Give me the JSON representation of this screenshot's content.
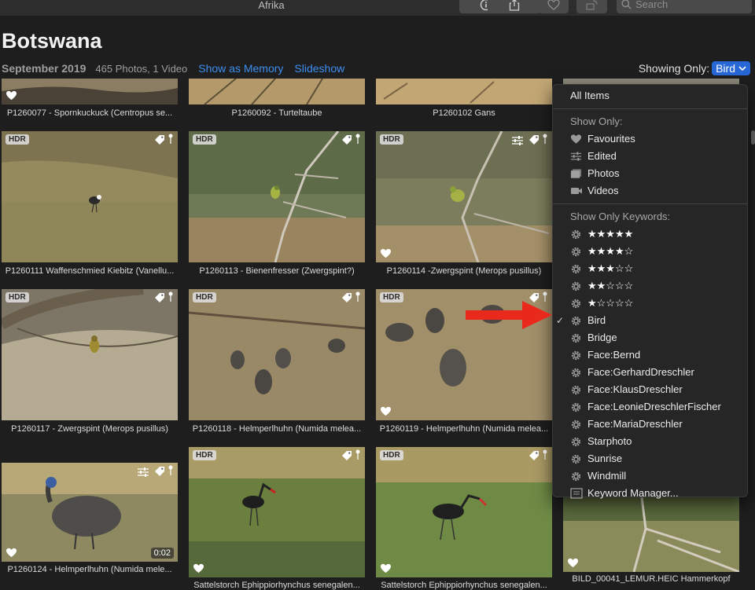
{
  "window": {
    "title": "Afrika"
  },
  "toolbar": {
    "search_placeholder": "Search"
  },
  "header": {
    "title": "Botswana",
    "date": "September 2019",
    "count": "465 Photos, 1 Video",
    "show_as_memory": "Show as Memory",
    "slideshow": "Slideshow",
    "showing_only_label": "Showing Only:",
    "filter_value": "Bird"
  },
  "photos": [
    {
      "caption": "P1260077 - Spornkuckuck (Centropus se...",
      "hdr": false,
      "tag": false,
      "adjusted": false,
      "favourite": true
    },
    {
      "caption": "P1260092 - Turteltaube",
      "hdr": false,
      "tag": false,
      "adjusted": false,
      "favourite": false
    },
    {
      "caption": "P1260102 Gans",
      "hdr": false,
      "tag": false,
      "adjusted": false,
      "favourite": false
    },
    {
      "caption": "P1260111 Waffenschmied Kiebitz (Vanellu...",
      "hdr": true,
      "hdr_label": "HDR",
      "tag": true,
      "adjusted": false,
      "favourite": false
    },
    {
      "caption": "P1260113 - Bienenfresser (Zwergspint?)",
      "hdr": true,
      "hdr_label": "HDR",
      "tag": true,
      "adjusted": false,
      "favourite": false
    },
    {
      "caption": "P1260114 -Zwergspint (Merops pusillus)",
      "hdr": true,
      "hdr_label": "HDR",
      "tag": true,
      "adjusted": true,
      "favourite": true
    },
    {
      "caption": "P1260117 - Zwergspint (Merops pusillus)",
      "hdr": true,
      "hdr_label": "HDR",
      "tag": true,
      "adjusted": false,
      "favourite": false
    },
    {
      "caption": "P1260118 - Helmperlhuhn (Numida melea...",
      "hdr": true,
      "hdr_label": "HDR",
      "tag": true,
      "adjusted": false,
      "favourite": false
    },
    {
      "caption": "P1260119 - Helmperlhuhn (Numida melea...",
      "hdr": true,
      "hdr_label": "HDR",
      "tag": true,
      "adjusted": false,
      "favourite": true
    },
    {
      "caption": "P1260124 - Helmperlhuhn (Numida mele...",
      "hdr": false,
      "tag": true,
      "adjusted": true,
      "favourite": true,
      "duration": "0:02"
    },
    {
      "caption": "Sattelstorch Ephippiorhynchus senegalen...",
      "hdr": true,
      "hdr_label": "HDR",
      "tag": true,
      "adjusted": false,
      "favourite": true
    },
    {
      "caption": "Sattelstorch Ephippiorhynchus senegalen...",
      "hdr": true,
      "hdr_label": "HDR",
      "tag": true,
      "adjusted": false,
      "favourite": true
    },
    {
      "caption": "BILD_00041_LEMUR.HEIC Hammerkopf",
      "hdr": false,
      "tag": false,
      "adjusted": false,
      "favourite": true
    }
  ],
  "menu": {
    "all_items": "All Items",
    "show_only_header": "Show Only:",
    "show_only": [
      {
        "label": "Favourites",
        "icon": "heart-icon"
      },
      {
        "label": "Edited",
        "icon": "sliders-icon"
      },
      {
        "label": "Photos",
        "icon": "photos-icon"
      },
      {
        "label": "Videos",
        "icon": "video-camera-icon"
      }
    ],
    "keywords_header": "Show Only Keywords:",
    "keywords": [
      {
        "label": "★★★★★",
        "stars": true
      },
      {
        "label": "★★★★☆",
        "stars": true
      },
      {
        "label": "★★★☆☆",
        "stars": true
      },
      {
        "label": "★★☆☆☆",
        "stars": true
      },
      {
        "label": "★☆☆☆☆",
        "stars": true
      },
      {
        "label": "Bird",
        "checked": true,
        "check": "✓"
      },
      {
        "label": "Bridge"
      },
      {
        "label": "Face:Bernd"
      },
      {
        "label": "Face:GerhardDreschler"
      },
      {
        "label": "Face:KlausDreschler"
      },
      {
        "label": "Face:LeonieDreschlerFischer"
      },
      {
        "label": "Face:MariaDreschler"
      },
      {
        "label": "Starphoto"
      },
      {
        "label": "Sunrise"
      },
      {
        "label": "Windmill"
      }
    ],
    "keyword_manager": "Keyword Manager..."
  },
  "colors": {
    "accent": "#2767d6",
    "link": "#3d8eef",
    "arrow": "#e8291c"
  }
}
